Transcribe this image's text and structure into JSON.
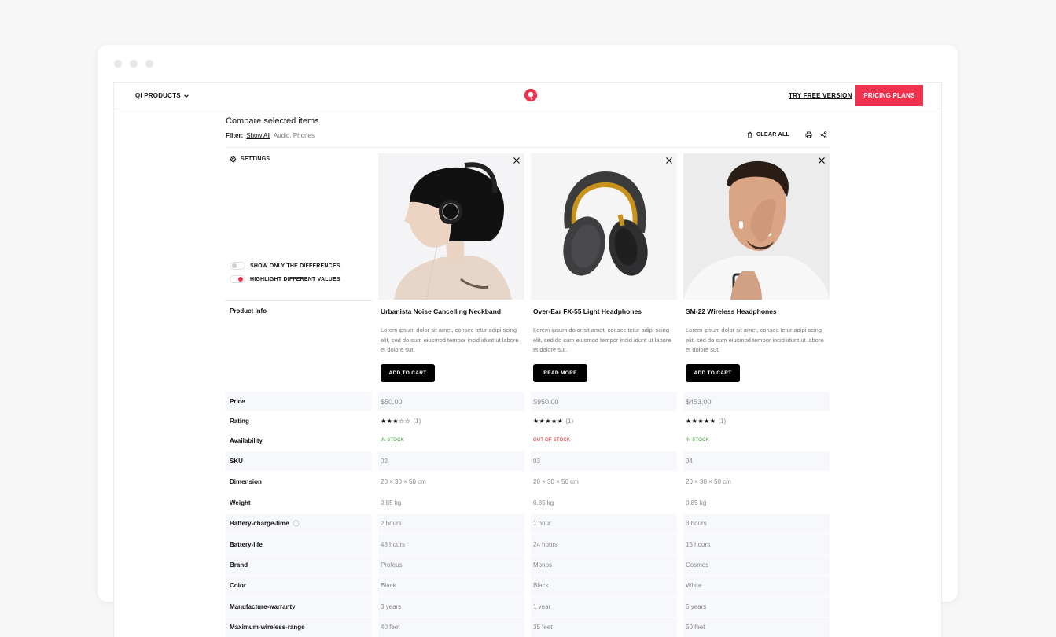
{
  "header": {
    "menu_label": "QI PRODUCTS",
    "try_free_label": "TRY FREE VERSION",
    "pricing_label": "PRICING PLANS",
    "brand_color": "#f0324f"
  },
  "compare": {
    "title": "Compare selected items",
    "filter_label": "Filter:",
    "filter_show_all": "Show All",
    "filter_others": "Audio, Phones",
    "clear_all_label": "CLEAR ALL",
    "settings_label": "SETTINGS",
    "toggles": [
      {
        "label": "SHOW ONLY THE DIFFERENCES",
        "on": false
      },
      {
        "label": "HIGHLIGHT DIFFERENT VALUES",
        "on": true
      }
    ],
    "product_info_label": "Product Info"
  },
  "products": [
    {
      "name": "Urbanista Noise Cancelling Neckband",
      "description": "Lorem ipsum dolor sit amet, consec tetur adipi scing elit, sed do sum eiusmod tempor incid idunt ut labore et dolore sut.",
      "button": "ADD TO CART"
    },
    {
      "name": "Over-Ear FX-55 Light Headphones",
      "description": "Lorem ipsum dolor sit amet, consec tetur adipi scing elit, sed do sum eiusmod tempor incid idunt ut labore et dolore sut.",
      "button": "READ MORE"
    },
    {
      "name": "SM-22 Wireless Headphones",
      "description": "Lorem ipsum dolor sit amet, consec tetur adipi scing elit, sed do sum eiusmod tempor incid idunt ut labore et dolore sut.",
      "button": "ADD TO CART"
    }
  ],
  "specs": {
    "price": {
      "label": "Price",
      "values": [
        "$50.00",
        "$950.00",
        "$453.00"
      ]
    },
    "rating": {
      "label": "Rating",
      "stars": [
        "★★★☆☆",
        "★★★★★",
        "★★★★★"
      ],
      "counts": [
        "(1)",
        "(1)",
        "(1)"
      ],
      "scores": [
        3,
        5,
        5
      ]
    },
    "availability": {
      "label": "Availability",
      "values": [
        "IN STOCK",
        "OUT OF STOCK",
        "IN STOCK"
      ],
      "colors": [
        "#3a9a3a",
        "#d0231f",
        "#3a9a3a"
      ]
    },
    "sku": {
      "label": "SKU",
      "values": [
        "02",
        "03",
        "04"
      ]
    },
    "dimension": {
      "label": "Dimension",
      "values": [
        "20 × 30 × 50 cm",
        "20 × 30 × 50 cm",
        "20 × 30 × 50 cm"
      ]
    },
    "weight": {
      "label": "Weight",
      "values": [
        "0.85 kg",
        "0.85 kg",
        "0.85 kg"
      ]
    },
    "battery_charge": {
      "label": "Battery-charge-time",
      "values": [
        "2 hours",
        "1 hour",
        "3 hours"
      ]
    },
    "battery_life": {
      "label": "Battery-life",
      "values": [
        "48 hours",
        "24 hours",
        "15 hours"
      ]
    },
    "brand": {
      "label": "Brand",
      "values": [
        "Profeus",
        "Monos",
        "Cosmos"
      ]
    },
    "color": {
      "label": "Color",
      "values": [
        "Black",
        "Black",
        "White"
      ]
    },
    "warranty": {
      "label": "Manufacture-warranty",
      "values": [
        "3 years",
        "1 year",
        "5 years"
      ]
    },
    "wireless_range": {
      "label": "Maximum-wireless-range",
      "values": [
        "40 feet",
        "35 feet",
        "50 feet"
      ]
    }
  }
}
